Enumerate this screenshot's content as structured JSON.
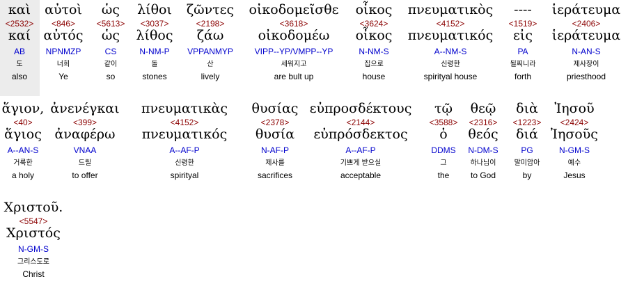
{
  "rows": [
    [
      {
        "greek": "καὶ",
        "strong": "<2532>",
        "lemma": "καί",
        "morph": "AB",
        "korean": "도",
        "english": "also"
      },
      {
        "greek": "αὐτοὶ",
        "strong": "<846>",
        "lemma": "αὐτός",
        "morph": "NPNMZP",
        "korean": "너희",
        "english": "Ye"
      },
      {
        "greek": "ὡς",
        "strong": "<5613>",
        "lemma": "ὡς",
        "morph": "CS",
        "korean": "같이",
        "english": "so"
      },
      {
        "greek": "λίθοι",
        "strong": "<3037>",
        "lemma": "λίθος",
        "morph": "N-NM-P",
        "korean": "돌",
        "english": "stones"
      },
      {
        "greek": "ζῶντες",
        "strong": "<2198>",
        "lemma": "ζάω",
        "morph": "VPPANMYP",
        "korean": "산",
        "english": "lively"
      },
      {
        "greek": "οἰκοδομεῖσθε",
        "strong": "<3618>",
        "lemma": "οἰκοδομέω",
        "morph": "VIPP--YP/VMPP--YP",
        "korean": "세워지고",
        "english": "are bult up"
      },
      {
        "greek": "οἶκος",
        "strong": "<3624>",
        "lemma": "οἶκος",
        "morph": "N-NM-S",
        "korean": "집으로",
        "english": "house"
      },
      {
        "greek": "πνευματικὸς",
        "strong": "<4152>",
        "lemma": "πνευματικός",
        "morph": "A--NM-S",
        "korean": "신령한",
        "english": "spirityal house"
      },
      {
        "greek": "----",
        "strong": "<1519>",
        "lemma": "εἰς",
        "morph": "PA",
        "korean": "될찌니라",
        "english": "forth"
      },
      {
        "greek": "ἱεράτευμα",
        "strong": "<2406>",
        "lemma": "ἱεράτευμα",
        "morph": "N-AN-S",
        "korean": "제사장이",
        "english": "priesthood"
      }
    ],
    [
      {
        "greek": "ἅγιον,",
        "strong": "<40>",
        "lemma": "ἅγιος",
        "morph": "A--AN-S",
        "korean": "거룩한",
        "english": "a holy"
      },
      {
        "greek": "ἀνενέγκαι",
        "strong": "<399>",
        "lemma": "ἀναφέρω",
        "morph": "VNAA",
        "korean": "드릴",
        "english": "to offer"
      },
      {
        "greek": "πνευματικὰς",
        "strong": "<4152>",
        "lemma": "πνευματικός",
        "morph": "A--AF-P",
        "korean": "신령한",
        "english": "spirityal"
      },
      {
        "greek": "θυσίας",
        "strong": "<2378>",
        "lemma": "θυσία",
        "morph": "N-AF-P",
        "korean": "제사를",
        "english": "sacrifices"
      },
      {
        "greek": "εὐπροσδέκτους",
        "strong": "<2144>",
        "lemma": "εὐπρόσδεκτος",
        "morph": "A--AF-P",
        "korean": "기쁘게 받으실",
        "english": "acceptable"
      },
      {
        "greek": "τῷ",
        "strong": "<3588>",
        "lemma": "ὁ",
        "morph": "DDMS",
        "korean": "그",
        "english": "the"
      },
      {
        "greek": "θεῷ",
        "strong": "<2316>",
        "lemma": "θεός",
        "morph": "N-DM-S",
        "korean": "하나님이",
        "english": "to God"
      },
      {
        "greek": "διὰ",
        "strong": "<1223>",
        "lemma": "διά",
        "morph": "PG",
        "korean": "말미암아",
        "english": "by"
      },
      {
        "greek": "Ἰησοῦ",
        "strong": "<2424>",
        "lemma": "Ἰησοῦς",
        "morph": "N-GM-S",
        "korean": "예수",
        "english": "Jesus"
      }
    ],
    [
      {
        "greek": "Χριστοῦ.",
        "strong": "<5547>",
        "lemma": "Χριστός",
        "morph": "N-GM-S",
        "korean": "그리스도로",
        "english": "Christ"
      }
    ]
  ]
}
